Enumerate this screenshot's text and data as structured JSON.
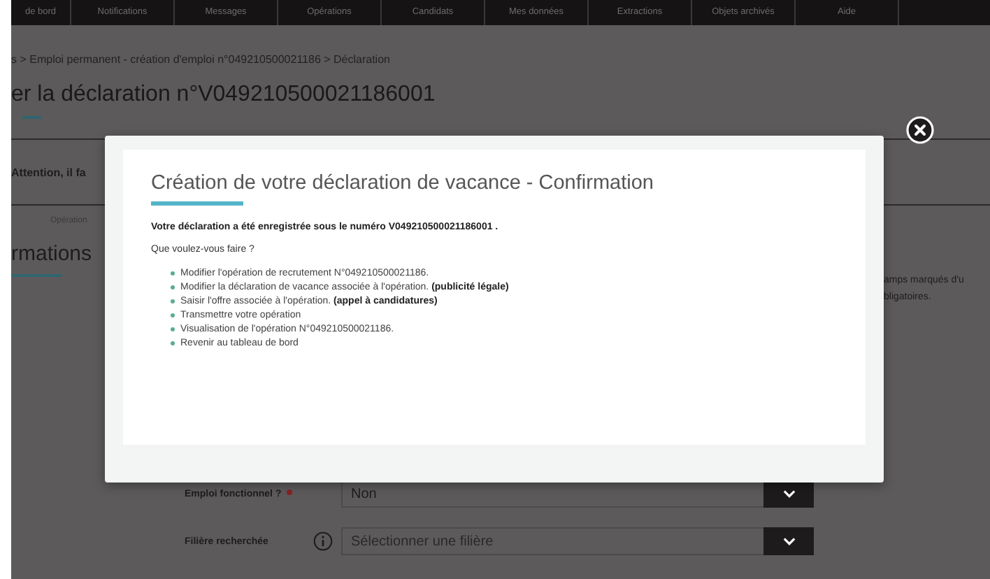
{
  "nav": [
    "de bord",
    "Notifications",
    "Messages",
    "Opérations",
    "Candidats",
    "Mes données",
    "Extractions",
    "Objets archivés",
    "Aide"
  ],
  "breadcrumb": "s > Emploi permanent - création d'emploi n°049210500021186 > Déclaration",
  "page_title": "er la déclaration n°V049210500021186001",
  "warning": "Attention, il fa",
  "step_label": "Opération",
  "section_title": "rmations",
  "required_note": [
    "amps marqués d'u",
    "bligatoires."
  ],
  "form": [
    {
      "label": "Emploi fonctionnel ?",
      "required": true,
      "info": false,
      "value": "Non"
    },
    {
      "label": "Filière recherchée",
      "required": false,
      "info": true,
      "placeholder": "Sélectionner une filière"
    }
  ],
  "modal": {
    "title": "Création de votre déclaration de vacance - Confirmation",
    "message": "Votre déclaration a été enregistrée sous le numéro V049210500021186001 .",
    "question": "Que voulez-vous faire ?",
    "actions": [
      "Modifier l'opération de recrutement N°049210500021186.",
      "Modifier la déclaration de vacance associée à l'opération. **(publicité légale)**",
      "Saisir l'offre associée à l'opération. **(appel à candidatures)**",
      "Transmettre votre opération",
      "Visualisation de l'opération N°049210500021186.",
      "Revenir au tableau de bord"
    ]
  }
}
